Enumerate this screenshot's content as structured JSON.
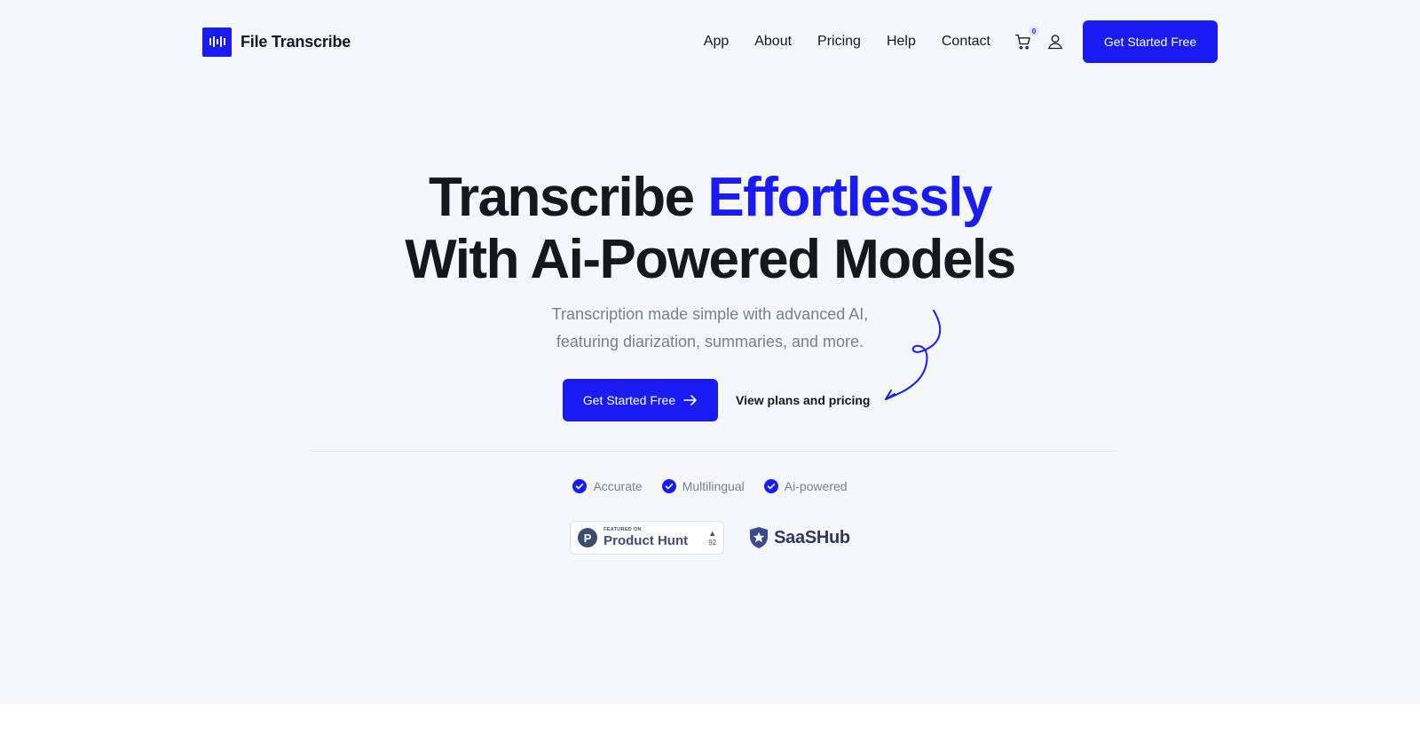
{
  "brand": {
    "name": "File Transcribe",
    "logo_icon": "waveform-icon"
  },
  "nav": {
    "links": [
      "App",
      "About",
      "Pricing",
      "Help",
      "Contact"
    ],
    "cart_count": "0",
    "cta_label": "Get Started Free"
  },
  "hero": {
    "headline_part1": "Transcribe ",
    "headline_accent": "Effortlessly",
    "headline_line2": "With Ai-Powered Models",
    "sub_line1": "Transcription made simple with advanced AI,",
    "sub_line2": "featuring diarization, summaries, and more.",
    "cta_label": "Get Started Free",
    "secondary_link": "View plans and pricing"
  },
  "features": [
    "Accurate",
    "Multilingual",
    "Ai-powered"
  ],
  "badges": {
    "product_hunt": {
      "small": "FEATURED ON",
      "name": "Product Hunt",
      "votes": "92"
    },
    "saashub": {
      "name": "SaaSHub"
    }
  },
  "colors": {
    "accent": "#1a1af2",
    "background": "#f5f7fd",
    "text": "#16181d",
    "muted": "#7a7f8c"
  }
}
